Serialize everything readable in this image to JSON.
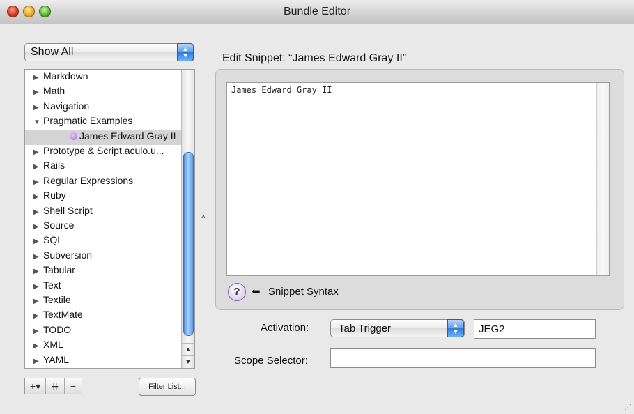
{
  "window": {
    "title": "Bundle Editor"
  },
  "filter_popup": {
    "selected": "Show All"
  },
  "bundle_list": {
    "items": [
      {
        "label": "Markdown",
        "expanded": false
      },
      {
        "label": "Math",
        "expanded": false
      },
      {
        "label": "Navigation",
        "expanded": false
      },
      {
        "label": "Pragmatic Examples",
        "expanded": true
      },
      {
        "label": "James Edward Gray II",
        "child": true,
        "selected": true
      },
      {
        "label": "Prototype & Script.aculo.u...",
        "expanded": false
      },
      {
        "label": "Rails",
        "expanded": false
      },
      {
        "label": "Regular Expressions",
        "expanded": false
      },
      {
        "label": "Ruby",
        "expanded": false
      },
      {
        "label": "Shell Script",
        "expanded": false
      },
      {
        "label": "Source",
        "expanded": false
      },
      {
        "label": "SQL",
        "expanded": false
      },
      {
        "label": "Subversion",
        "expanded": false
      },
      {
        "label": "Tabular",
        "expanded": false
      },
      {
        "label": "Text",
        "expanded": false
      },
      {
        "label": "Textile",
        "expanded": false
      },
      {
        "label": "TextMate",
        "expanded": false
      },
      {
        "label": "TODO",
        "expanded": false
      },
      {
        "label": "XML",
        "expanded": false
      },
      {
        "label": "YAML",
        "expanded": false
      }
    ]
  },
  "bottom_buttons": {
    "add": "+▾",
    "add_item": "⧺",
    "remove": "−",
    "filter_list": "Filter List..."
  },
  "editor": {
    "heading": "Edit Snippet: “James Edward Gray II”",
    "content": "James Edward Gray II"
  },
  "help": {
    "icon": "?",
    "arrow": "⬅",
    "label": "Snippet Syntax"
  },
  "activation": {
    "label": "Activation:",
    "selected": "Tab Trigger",
    "trigger_value": "JEG2"
  },
  "scope": {
    "label": "Scope Selector:",
    "value": ""
  },
  "colors": {
    "selection": "#d4d4d4",
    "accent_blue": "#2d7bdf"
  }
}
